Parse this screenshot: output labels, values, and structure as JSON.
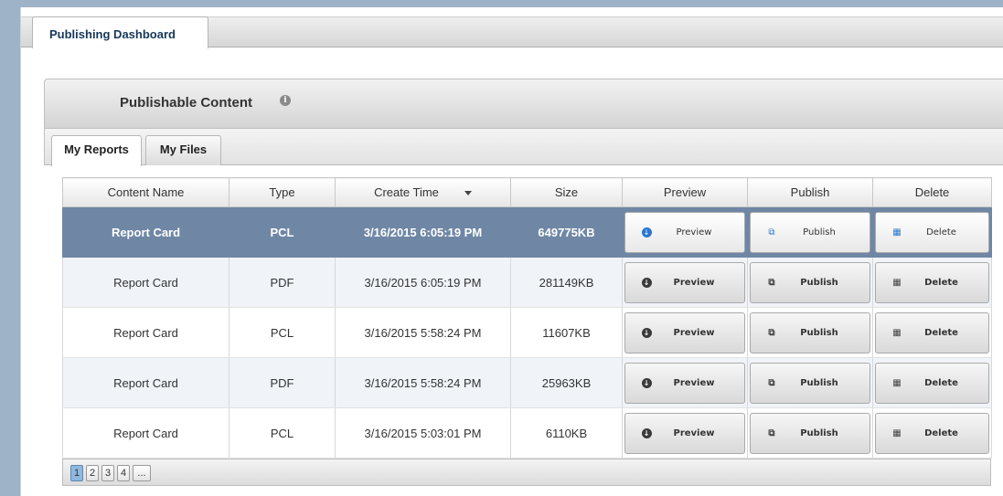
{
  "window_tab": {
    "label": "Publishing Dashboard"
  },
  "panel": {
    "title": "Publishable Content",
    "info_icon": "i"
  },
  "subtabs": [
    {
      "label": "My Reports"
    },
    {
      "label": "My Files"
    }
  ],
  "table": {
    "columns": [
      "Content Name",
      "Type",
      "Create Time",
      "Size",
      "Preview",
      "Publish",
      "Delete"
    ],
    "sorted_column": "Create Time",
    "rows": [
      {
        "name": "Report Card",
        "type": "PCL",
        "time": "3/16/2015 6:05:19 PM",
        "size": "649775KB",
        "preview": "Preview",
        "publish": "Publish",
        "delete": "Delete",
        "selected": true
      },
      {
        "name": "Report Card",
        "type": "PDF",
        "time": "3/16/2015 6:05:19 PM",
        "size": "281149KB",
        "preview": "Preview",
        "publish": "Publish",
        "delete": "Delete"
      },
      {
        "name": "Report Card",
        "type": "PCL",
        "time": "3/16/2015 5:58:24 PM",
        "size": "11607KB",
        "preview": "Preview",
        "publish": "Publish",
        "delete": "Delete"
      },
      {
        "name": "Report Card",
        "type": "PDF",
        "time": "3/16/2015 5:58:24 PM",
        "size": "25963KB",
        "preview": "Preview",
        "publish": "Publish",
        "delete": "Delete"
      },
      {
        "name": "Report Card",
        "type": "PCL",
        "time": "3/16/2015 5:03:01 PM",
        "size": "6110KB",
        "preview": "Preview",
        "publish": "Publish",
        "delete": "Delete"
      }
    ]
  },
  "pager": {
    "pages": [
      "1",
      "2",
      "3",
      "4",
      "..."
    ],
    "current": "1"
  },
  "colors": {
    "selected_row": "#6f87a5",
    "alt_row": "#f0f4f9",
    "title_text": "#16375b"
  },
  "icons": {
    "preview": "download-circle-icon",
    "publish": "copy-icon",
    "delete": "trash-icon",
    "info": "info-icon",
    "sort": "sort-down-icon"
  }
}
